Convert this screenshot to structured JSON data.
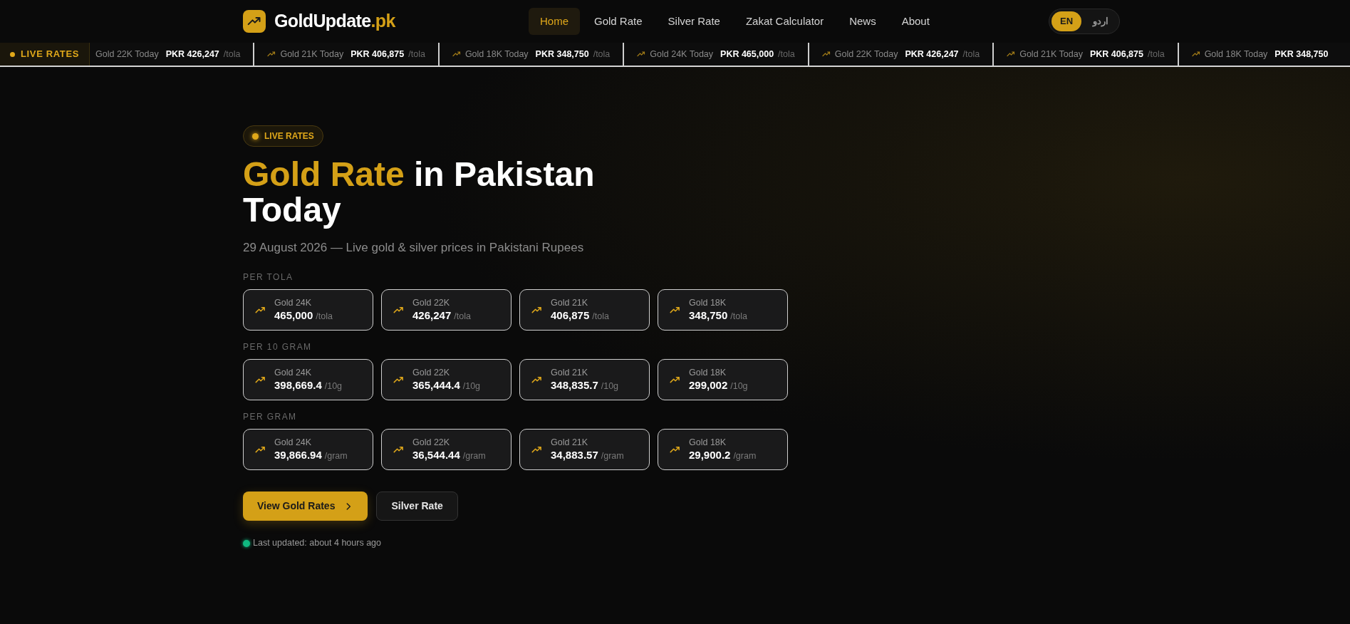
{
  "header": {
    "logo": {
      "name": "GoldUpdate",
      "suffix": ".pk"
    },
    "nav": [
      {
        "label": "Home",
        "selected": true
      },
      {
        "label": "Gold Rate",
        "selected": false
      },
      {
        "label": "Silver Rate",
        "selected": false
      },
      {
        "label": "Zakat Calculator",
        "selected": false
      },
      {
        "label": "News",
        "selected": false
      },
      {
        "label": "About",
        "selected": false
      }
    ],
    "languages": [
      {
        "label": "EN",
        "selected": true
      },
      {
        "label": "اردو",
        "selected": false
      }
    ]
  },
  "ticker": {
    "badge": "LIVE RATES",
    "items": [
      {
        "label": "Gold 22K Today",
        "price": "PKR 426,247",
        "unit": "/tola",
        "icon": false
      },
      {
        "label": "Gold 21K Today",
        "price": "PKR 406,875",
        "unit": "/tola",
        "icon": true
      },
      {
        "label": "Gold 18K Today",
        "price": "PKR 348,750",
        "unit": "/tola",
        "icon": true
      },
      {
        "label": "Gold 24K Today",
        "price": "PKR 465,000",
        "unit": "/tola",
        "icon": true
      },
      {
        "label": "Gold 22K Today",
        "price": "PKR 426,247",
        "unit": "/tola",
        "icon": true
      },
      {
        "label": "Gold 21K Today",
        "price": "PKR 406,875",
        "unit": "/tola",
        "icon": true
      },
      {
        "label": "Gold 18K Today",
        "price": "PKR 348,750",
        "icon": true
      }
    ]
  },
  "hero": {
    "badge": "LIVE RATES",
    "title_highlight": "Gold Rate",
    "title_rest": "in Pakistan Today",
    "subtitle": "29 August 2026 — Live gold & silver prices in Pakistani Rupees",
    "groups": [
      {
        "label": "PER TOLA",
        "cards": [
          {
            "name": "Gold 24K",
            "value": "465,000",
            "unit": "/tola"
          },
          {
            "name": "Gold 22K",
            "value": "426,247",
            "unit": "/tola"
          },
          {
            "name": "Gold 21K",
            "value": "406,875",
            "unit": "/tola"
          },
          {
            "name": "Gold 18K",
            "value": "348,750",
            "unit": "/tola"
          }
        ]
      },
      {
        "label": "PER 10 GRAM",
        "cards": [
          {
            "name": "Gold 24K",
            "value": "398,669.4",
            "unit": "/10g"
          },
          {
            "name": "Gold 22K",
            "value": "365,444.4",
            "unit": "/10g"
          },
          {
            "name": "Gold 21K",
            "value": "348,835.7",
            "unit": "/10g"
          },
          {
            "name": "Gold 18K",
            "value": "299,002",
            "unit": "/10g"
          }
        ]
      },
      {
        "label": "PER GRAM",
        "cards": [
          {
            "name": "Gold 24K",
            "value": "39,866.94",
            "unit": "/gram"
          },
          {
            "name": "Gold 22K",
            "value": "36,544.44",
            "unit": "/gram"
          },
          {
            "name": "Gold 21K",
            "value": "34,883.57",
            "unit": "/gram"
          },
          {
            "name": "Gold 18K",
            "value": "29,900.2",
            "unit": "/gram"
          }
        ]
      }
    ],
    "buttons": [
      {
        "label": "View Gold Rates",
        "kind": "primary"
      },
      {
        "label": "Silver Rate",
        "kind": "secondary"
      }
    ],
    "updated": "Last updated: about 4 hours ago"
  }
}
